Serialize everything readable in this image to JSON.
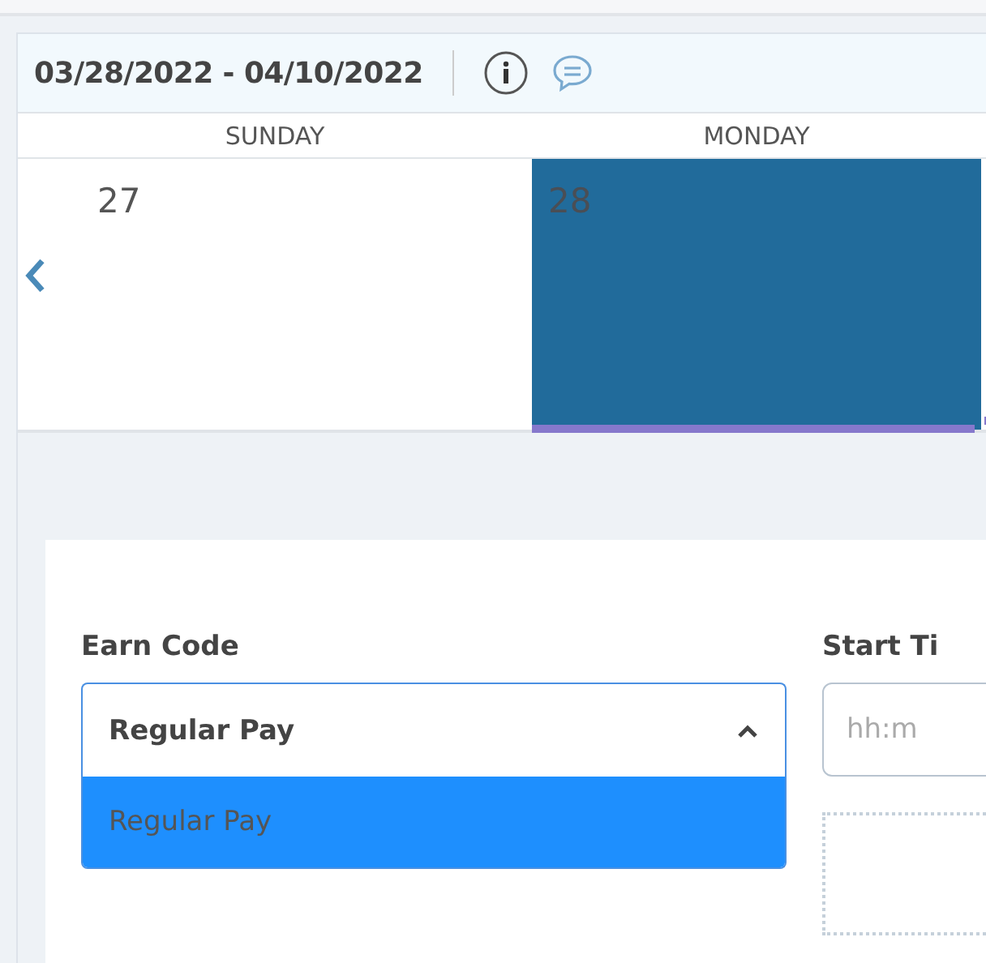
{
  "header": {
    "date_range": "03/28/2022 - 04/10/2022"
  },
  "days": [
    {
      "name": "SUNDAY",
      "date": "27",
      "selected": false
    },
    {
      "name": "MONDAY",
      "date": "28",
      "selected": true
    }
  ],
  "form": {
    "earn_code": {
      "label": "Earn Code",
      "value": "Regular Pay",
      "expanded": true,
      "options": [
        {
          "label": "Regular Pay",
          "selected": true
        }
      ]
    },
    "start_time": {
      "label": "Start Ti",
      "placeholder": "hh:m"
    }
  }
}
